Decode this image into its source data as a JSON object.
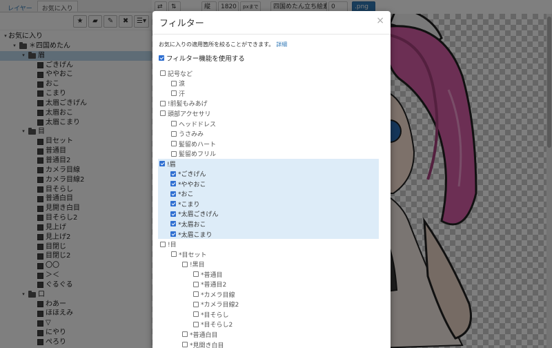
{
  "sidebar": {
    "tabs": [
      "レイヤー",
      "お気に入り"
    ],
    "tree": [
      {
        "label": "お気に入り",
        "depth": 0,
        "type": "root"
      },
      {
        "label": "＊四国めたん",
        "depth": 1,
        "type": "folder"
      },
      {
        "label": "眉",
        "depth": 2,
        "type": "folder",
        "selected": true
      },
      {
        "label": "ごきげん",
        "depth": 3,
        "type": "layer"
      },
      {
        "label": "ややおこ",
        "depth": 3,
        "type": "layer"
      },
      {
        "label": "おこ",
        "depth": 3,
        "type": "layer"
      },
      {
        "label": "こまり",
        "depth": 3,
        "type": "layer"
      },
      {
        "label": "太眉ごきげん",
        "depth": 3,
        "type": "layer"
      },
      {
        "label": "太眉おこ",
        "depth": 3,
        "type": "layer"
      },
      {
        "label": "太眉こまり",
        "depth": 3,
        "type": "layer"
      },
      {
        "label": "目",
        "depth": 2,
        "type": "folder"
      },
      {
        "label": "目セット",
        "depth": 3,
        "type": "layer"
      },
      {
        "label": "普通目",
        "depth": 3,
        "type": "layer"
      },
      {
        "label": "普通目2",
        "depth": 3,
        "type": "layer"
      },
      {
        "label": "カメラ目線",
        "depth": 3,
        "type": "layer"
      },
      {
        "label": "カメラ目線2",
        "depth": 3,
        "type": "layer"
      },
      {
        "label": "目そらし",
        "depth": 3,
        "type": "layer"
      },
      {
        "label": "普通白目",
        "depth": 3,
        "type": "layer"
      },
      {
        "label": "見開き白目",
        "depth": 3,
        "type": "layer"
      },
      {
        "label": "目そらし2",
        "depth": 3,
        "type": "layer"
      },
      {
        "label": "見上げ",
        "depth": 3,
        "type": "layer"
      },
      {
        "label": "見上げ2",
        "depth": 3,
        "type": "layer"
      },
      {
        "label": "目閉じ",
        "depth": 3,
        "type": "layer"
      },
      {
        "label": "目閉じ2",
        "depth": 3,
        "type": "layer"
      },
      {
        "label": "〇〇",
        "depth": 3,
        "type": "layer"
      },
      {
        "label": "＞＜",
        "depth": 3,
        "type": "layer"
      },
      {
        "label": "ぐるぐる",
        "depth": 3,
        "type": "layer"
      },
      {
        "label": "口",
        "depth": 2,
        "type": "folder"
      },
      {
        "label": "わあー",
        "depth": 3,
        "type": "layer"
      },
      {
        "label": "ほほえみ",
        "depth": 3,
        "type": "layer"
      },
      {
        "label": "▽",
        "depth": 3,
        "type": "layer"
      },
      {
        "label": "にやり",
        "depth": 3,
        "type": "layer"
      },
      {
        "label": "ぺろり",
        "depth": 3,
        "type": "layer"
      }
    ]
  },
  "topbar": {
    "size_label": "縦",
    "size_value": "1820",
    "unit_label": "pxまで",
    "filename": "四国めたん立ち絵素材",
    "number": "0",
    "export_button": ".png"
  },
  "modal": {
    "title": "フィルター",
    "close": "×",
    "description": "お気に入りの適用箇所を絞ることができます。",
    "details_link": "詳細",
    "enable_label": "フィルター機能を使用する",
    "enable_checked": true,
    "items": [
      {
        "label": "記号など",
        "depth": 0,
        "checked": false
      },
      {
        "label": "涙",
        "depth": 1,
        "checked": false
      },
      {
        "label": "汗",
        "depth": 1,
        "checked": false
      },
      {
        "label": "!前髪もみあげ",
        "depth": 0,
        "checked": false
      },
      {
        "label": "頭部アクセサリ",
        "depth": 0,
        "checked": false
      },
      {
        "label": "ヘッドドレス",
        "depth": 1,
        "checked": false
      },
      {
        "label": "うさみみ",
        "depth": 1,
        "checked": false
      },
      {
        "label": "髪留めハート",
        "depth": 1,
        "checked": false
      },
      {
        "label": "髪留めフリル",
        "depth": 1,
        "checked": false
      },
      {
        "label": "!眉",
        "depth": 0,
        "checked": true,
        "highlight": true
      },
      {
        "label": "*ごきげん",
        "depth": 1,
        "checked": true,
        "highlight": true
      },
      {
        "label": "*ややおこ",
        "depth": 1,
        "checked": true,
        "highlight": true
      },
      {
        "label": "*おこ",
        "depth": 1,
        "checked": true,
        "highlight": true
      },
      {
        "label": "*こまり",
        "depth": 1,
        "checked": true,
        "highlight": true
      },
      {
        "label": "*太眉ごきげん",
        "depth": 1,
        "checked": true,
        "highlight": true
      },
      {
        "label": "*太眉おこ",
        "depth": 1,
        "checked": true,
        "highlight": true
      },
      {
        "label": "*太眉こまり",
        "depth": 1,
        "checked": true,
        "highlight": true
      },
      {
        "label": "!目",
        "depth": 0,
        "checked": false
      },
      {
        "label": "*目セット",
        "depth": 1,
        "checked": false
      },
      {
        "label": "!黒目",
        "depth": 2,
        "checked": false
      },
      {
        "label": "*普通目",
        "depth": 3,
        "checked": false
      },
      {
        "label": "*普通目2",
        "depth": 3,
        "checked": false
      },
      {
        "label": "*カメラ目線",
        "depth": 3,
        "checked": false
      },
      {
        "label": "*カメラ目線2",
        "depth": 3,
        "checked": false
      },
      {
        "label": "*目そらし",
        "depth": 3,
        "checked": false
      },
      {
        "label": "*目そらし2",
        "depth": 3,
        "checked": false
      },
      {
        "label": "*普通白目",
        "depth": 2,
        "checked": false
      },
      {
        "label": "*見開き白目",
        "depth": 2,
        "checked": false
      }
    ]
  },
  "colors": {
    "accent": "#337ab7",
    "checkbox": "#2f6fd1",
    "highlight_bg": "#ddecf8",
    "selection_bg": "#bcd8ec"
  }
}
